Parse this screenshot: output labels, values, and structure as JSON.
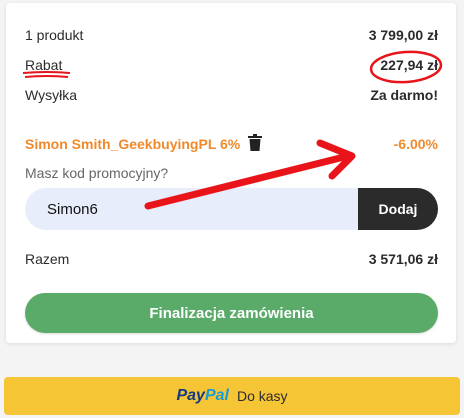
{
  "summary": {
    "products_label": "1 produkt",
    "products_value": "3 799,00 zł",
    "discount_label": "Rabat",
    "discount_value": "227,94 zł",
    "shipping_label": "Wysyłka",
    "shipping_value": "Za darmo!"
  },
  "coupon": {
    "name": "Simon Smith_GeekbuyingPL 6%",
    "percent": "-6.00%",
    "remove_icon": "trash-icon"
  },
  "promo": {
    "label": "Masz kod promocyjny?",
    "input_value": "Simon6",
    "apply_label": "Dodaj"
  },
  "total": {
    "label": "Razem",
    "value": "3 571,06 zł"
  },
  "checkout_label": "Finalizacja zamówienia",
  "paypal": {
    "logo_pay": "Pay",
    "logo_pal": "Pal",
    "label": "Do kasy"
  },
  "colors": {
    "accent_orange": "#ef8a2c",
    "checkout_green": "#5aab69",
    "paypal_yellow": "#f6c535",
    "annotation_red": "#e8141a"
  }
}
